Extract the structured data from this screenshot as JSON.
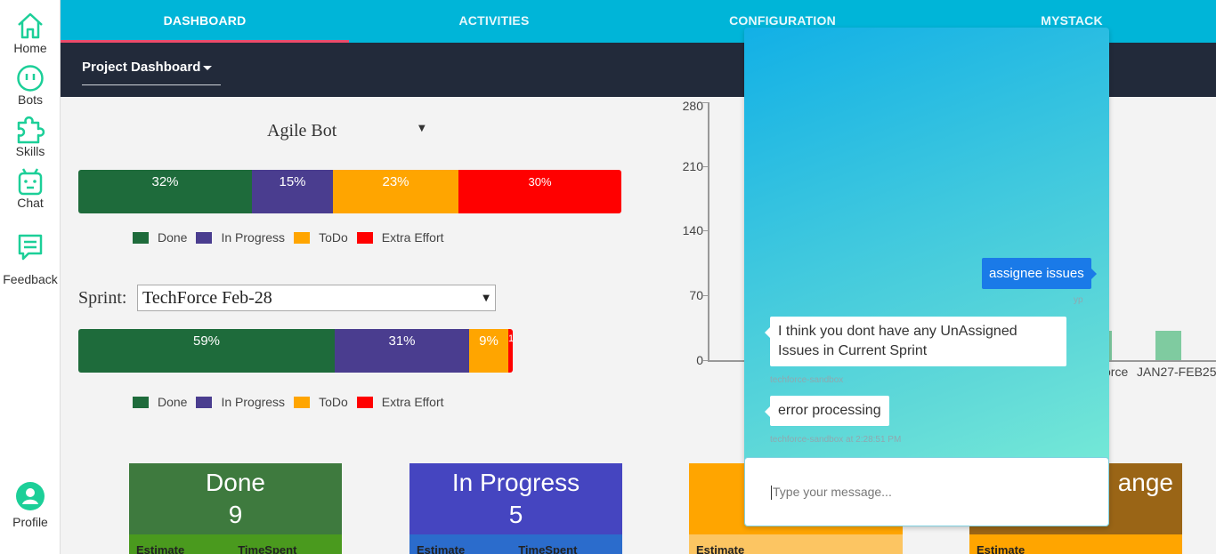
{
  "sidebar": {
    "items": [
      {
        "label": "Home",
        "icon": "home-icon"
      },
      {
        "label": "Bots",
        "icon": "bot-icon"
      },
      {
        "label": "Skills",
        "icon": "puzzle-icon"
      },
      {
        "label": "Chat",
        "icon": "robot-face-icon"
      },
      {
        "label": "Feedback",
        "icon": "message-icon"
      },
      {
        "label": "Profile",
        "icon": "user-avatar-icon"
      }
    ],
    "accent": "#1ccf98"
  },
  "topnav": {
    "tabs": [
      {
        "label": "DASHBOARD",
        "active": true
      },
      {
        "label": "ACTIVITIES",
        "active": false
      },
      {
        "label": "CONFIGURATION",
        "active": false
      },
      {
        "label": "MYSTACK",
        "active": false
      }
    ],
    "bg": "#00b5d8"
  },
  "subheader": {
    "project_select": "Project Dashboard"
  },
  "bot_select": {
    "value": "Agile Bot"
  },
  "overall_progress": {
    "segments": [
      {
        "label": "32%",
        "value": 32,
        "color": "#1e6b3b"
      },
      {
        "label": "15%",
        "value": 15,
        "color": "#4a3d8f"
      },
      {
        "label": "23%",
        "value": 23,
        "color": "#ffa500"
      },
      {
        "label": "30%",
        "value": 30,
        "color": "#ff0000"
      }
    ]
  },
  "legend": [
    "Done",
    "In Progress",
    "ToDo",
    "Extra Effort"
  ],
  "sprint": {
    "label": "Sprint:",
    "value": "TechForce Feb-28"
  },
  "sprint_progress": {
    "segments": [
      {
        "label": "59%",
        "value": 59,
        "color": "#1e6b3b"
      },
      {
        "label": "31%",
        "value": 31,
        "color": "#4a3d8f"
      },
      {
        "label": "9%",
        "value": 9,
        "color": "#ffa500"
      },
      {
        "label": "1",
        "value": 1,
        "color": "#ff0000"
      }
    ]
  },
  "cards": [
    {
      "title": "Done",
      "count": "9",
      "foot": [
        "Estimate",
        "TimeSpent"
      ],
      "color": "#3e7a3e",
      "foot_color": "#4a9a1e"
    },
    {
      "title": "In Progress",
      "count": "5",
      "foot": [
        "Estimate",
        "TimeSpent"
      ],
      "color": "#4545c0",
      "foot_color": "#2b6ccc"
    },
    {
      "title": "",
      "count": "",
      "foot": [
        "Estimate"
      ],
      "color": "#ffa500",
      "foot_color": "#fcc562"
    },
    {
      "title": "ange",
      "count": "",
      "foot": [
        "Estimate"
      ],
      "color": "#9a6516",
      "foot_color": "#ffa500"
    }
  ],
  "chart_data": {
    "type": "bar",
    "yticks": [
      "280",
      "210",
      "140",
      "70",
      "0"
    ],
    "ylim": [
      0,
      280
    ],
    "categories": [
      "orce",
      "JAN27-FEB25"
    ],
    "values": [
      32,
      32
    ]
  },
  "chat": {
    "messages": [
      {
        "from": "user",
        "text": "assignee issues",
        "meta": "yp"
      },
      {
        "from": "bot",
        "text": "I think you dont have any UnAssigned Issues in Current Sprint",
        "meta": "techforce-sandbox"
      },
      {
        "from": "bot",
        "text": "error processing",
        "meta": "techforce-sandbox at 2:28:51 PM"
      }
    ],
    "input_placeholder": "Type your message..."
  }
}
